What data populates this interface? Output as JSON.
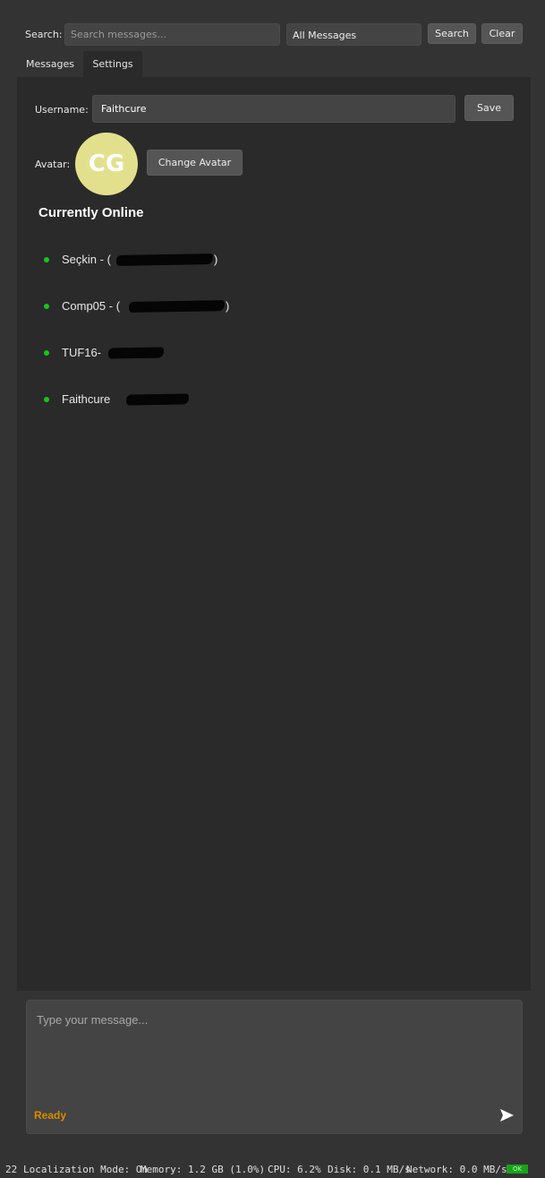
{
  "toolbar": {
    "search_label": "Search:",
    "search_placeholder": "Search messages...",
    "search_value": "",
    "filter_selected": "All Messages",
    "search_button": "Search",
    "clear_button": "Clear"
  },
  "tabs": [
    {
      "label": "Messages",
      "active": false
    },
    {
      "label": "Settings",
      "active": true
    }
  ],
  "settings": {
    "username_label": "Username:",
    "username_value": "Faithcure",
    "save_button": "Save",
    "avatar_label": "Avatar:",
    "avatar_initials": "CG",
    "avatar_color": "#e3e08d",
    "change_avatar_button": "Change Avatar"
  },
  "online": {
    "title": "Currently Online",
    "status_color": "#19c519",
    "users": [
      {
        "name": "Seçkin - (",
        "suffix": ")",
        "redacted": true
      },
      {
        "name": "Comp05 - (",
        "suffix": ")",
        "redacted": true
      },
      {
        "name": "TUF16-",
        "suffix": "",
        "redacted": true
      },
      {
        "name": "Faithcure",
        "suffix": "",
        "redacted": true
      }
    ]
  },
  "compose": {
    "placeholder": "Type your message...",
    "value": "",
    "status": "Ready",
    "status_color": "#d98b00",
    "send_icon": "send-icon"
  },
  "statusbar": {
    "prefix": "22",
    "localization": "Localization Mode: On",
    "memory": "Memory: 1.2 GB (1.0%)",
    "cpu": "CPU: 6.2%",
    "disk": "Disk: 0.1 MB/s",
    "network": "Network: 0.0 MB/s",
    "badge": "OK",
    "badge_color": "#1aa11a"
  }
}
